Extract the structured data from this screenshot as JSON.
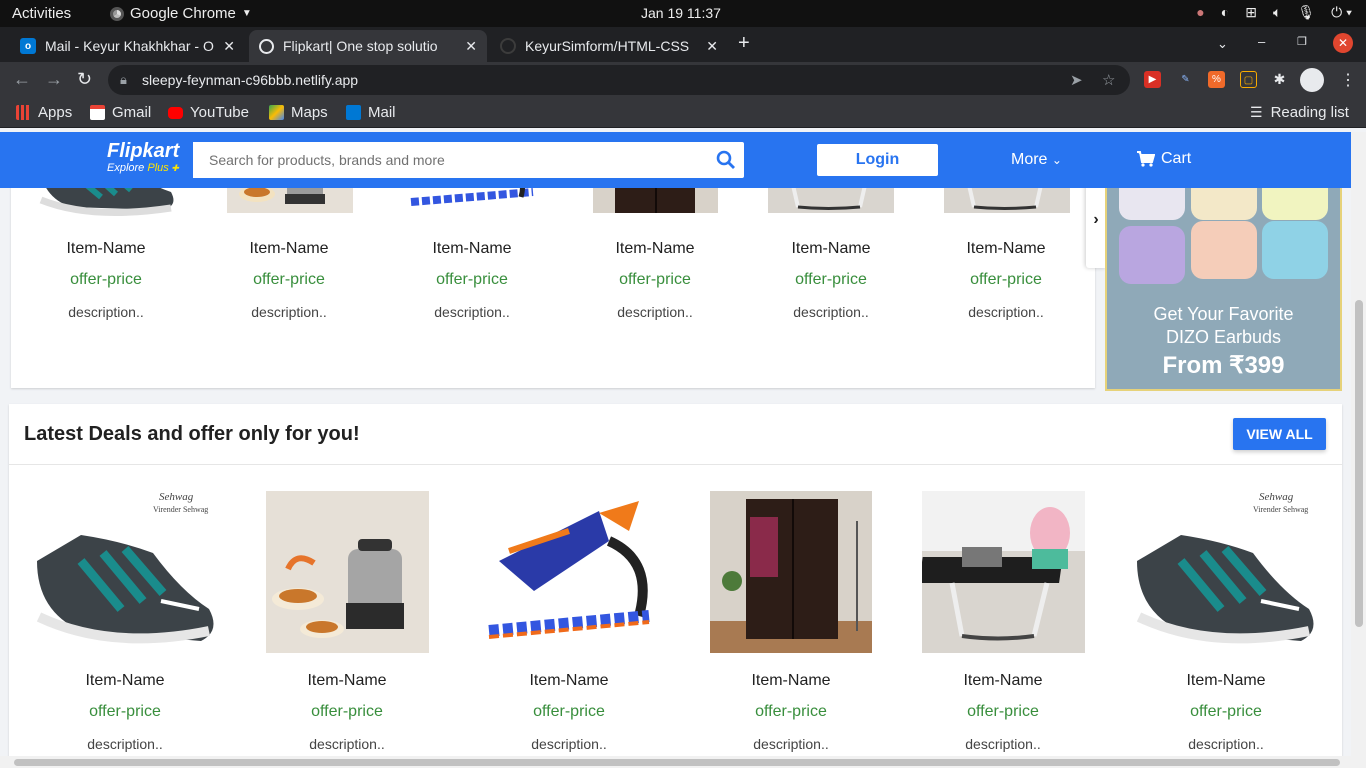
{
  "system_bar": {
    "activities": "Activities",
    "app_name": "Google Chrome",
    "clock": "Jan 19  11:37"
  },
  "browser": {
    "tabs": [
      {
        "title": "Mail - Keyur Khakhkhar - O",
        "close": "✕"
      },
      {
        "title": "Flipkart| One stop solutio",
        "close": "✕"
      },
      {
        "title": "KeyurSimform/HTML-CSS",
        "close": "✕"
      }
    ],
    "url": "sleepy-feynman-c96bbb.netlify.app",
    "bookmarks": [
      {
        "label": "Apps"
      },
      {
        "label": "Gmail"
      },
      {
        "label": "YouTube"
      },
      {
        "label": "Maps"
      },
      {
        "label": "Mail"
      }
    ],
    "reading_list": "Reading list"
  },
  "header": {
    "logo": "Flipkart",
    "logo_tag_prefix": "Explore ",
    "logo_tag_plus": "Plus",
    "search_placeholder": "Search for products, brands and more",
    "login": "Login",
    "more": "More",
    "cart": "Cart"
  },
  "top_section": {
    "items": [
      {
        "name": "Item-Name",
        "price": "offer-price",
        "desc": "description.."
      },
      {
        "name": "Item-Name",
        "price": "offer-price",
        "desc": "description.."
      },
      {
        "name": "Item-Name",
        "price": "offer-price",
        "desc": "description.."
      },
      {
        "name": "Item-Name",
        "price": "offer-price",
        "desc": "description.."
      },
      {
        "name": "Item-Name",
        "price": "offer-price",
        "desc": "description.."
      },
      {
        "name": "Item-Name",
        "price": "offer-price",
        "desc": "description.."
      }
    ]
  },
  "banner": {
    "line1": "Get Your Favorite",
    "line2": "DIZO Earbuds",
    "price": "From ₹399"
  },
  "deals": {
    "title": "Latest Deals and offer only for you!",
    "view_all": "VIEW ALL",
    "items": [
      {
        "name": "Item-Name",
        "price": "offer-price",
        "desc": "description.."
      },
      {
        "name": "Item-Name",
        "price": "offer-price",
        "desc": "description.."
      },
      {
        "name": "Item-Name",
        "price": "offer-price",
        "desc": "description.."
      },
      {
        "name": "Item-Name",
        "price": "offer-price",
        "desc": "description.."
      },
      {
        "name": "Item-Name",
        "price": "offer-price",
        "desc": "description.."
      },
      {
        "name": "Item-Name",
        "price": "offer-price",
        "desc": "description.."
      }
    ],
    "shoe_brand": "Sehwag",
    "shoe_brand_sub": "Virender Sehwag"
  },
  "colors": {
    "flipkart_blue": "#2874f0",
    "offer_green": "#388e3c",
    "logo_yellow": "#ffe500"
  }
}
